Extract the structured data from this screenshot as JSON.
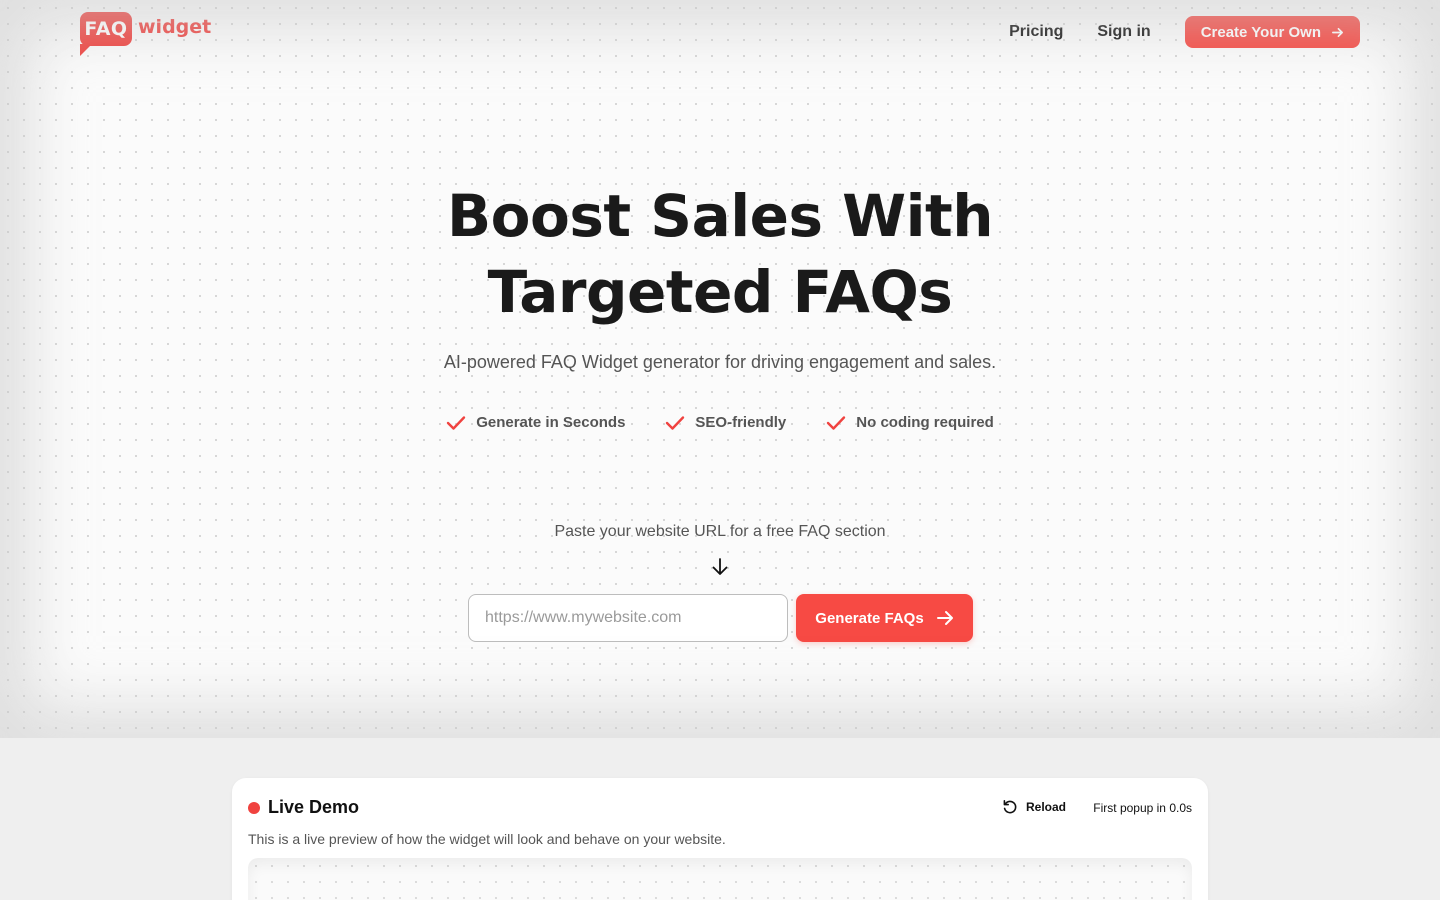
{
  "header": {
    "logo_badge": "FAQ",
    "logo_word": "widget",
    "nav": {
      "pricing": "Pricing",
      "sign_in": "Sign in",
      "cta": "Create Your Own"
    }
  },
  "hero": {
    "headline_line1": "Boost Sales With",
    "headline_line2": "Targeted FAQs",
    "subhead": "AI-powered FAQ Widget generator for driving engagement and sales.",
    "features": [
      "Generate in Seconds",
      "SEO-friendly",
      "No coding required"
    ],
    "paste_label": "Paste your website URL for a free FAQ section",
    "url_placeholder": "https://www.mywebsite.com",
    "url_value": "",
    "generate_button": "Generate FAQs"
  },
  "demo": {
    "title": "Live Demo",
    "reload_label": "Reload",
    "timer_text": "First popup in 0.0s",
    "description": "This is a live preview of how the widget will look and behave on your website."
  },
  "colors": {
    "accent": "#f74a44",
    "logo_red": "#f0423f",
    "background": "#efefef"
  },
  "icons": {
    "nav_cta": "arrow-right-icon",
    "feature": "check-icon",
    "paste": "arrow-down-icon",
    "generate": "arrow-right-icon",
    "reload": "reload-icon"
  }
}
